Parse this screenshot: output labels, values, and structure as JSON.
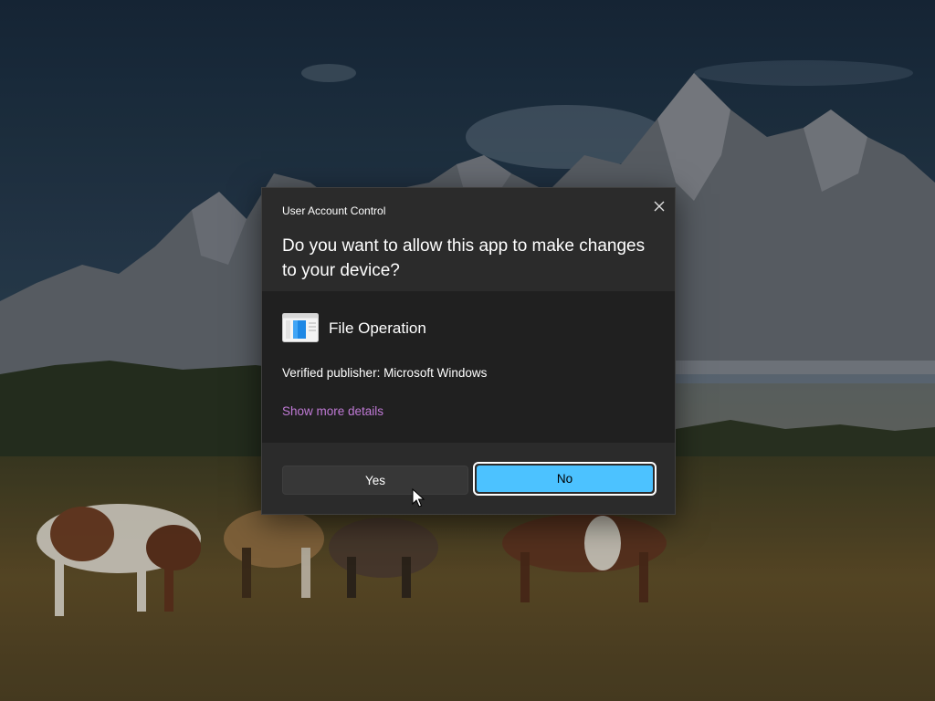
{
  "dialog": {
    "title": "User Account Control",
    "question": "Do you want to allow this app to make changes to your device?",
    "close_icon": "close-icon",
    "app": {
      "name": "File Operation",
      "icon": "file-operation-app-icon"
    },
    "publisher_line": "Verified publisher: Microsoft Windows",
    "show_more_details": "Show more details",
    "buttons": {
      "yes_label": "Yes",
      "no_label": "No"
    }
  },
  "colors": {
    "dialog_background": "#2b2b2b",
    "body_background": "#202020",
    "accent_button": "#4cc2ff",
    "link": "#c07ad6"
  },
  "cursor": "mouse-pointer-icon"
}
